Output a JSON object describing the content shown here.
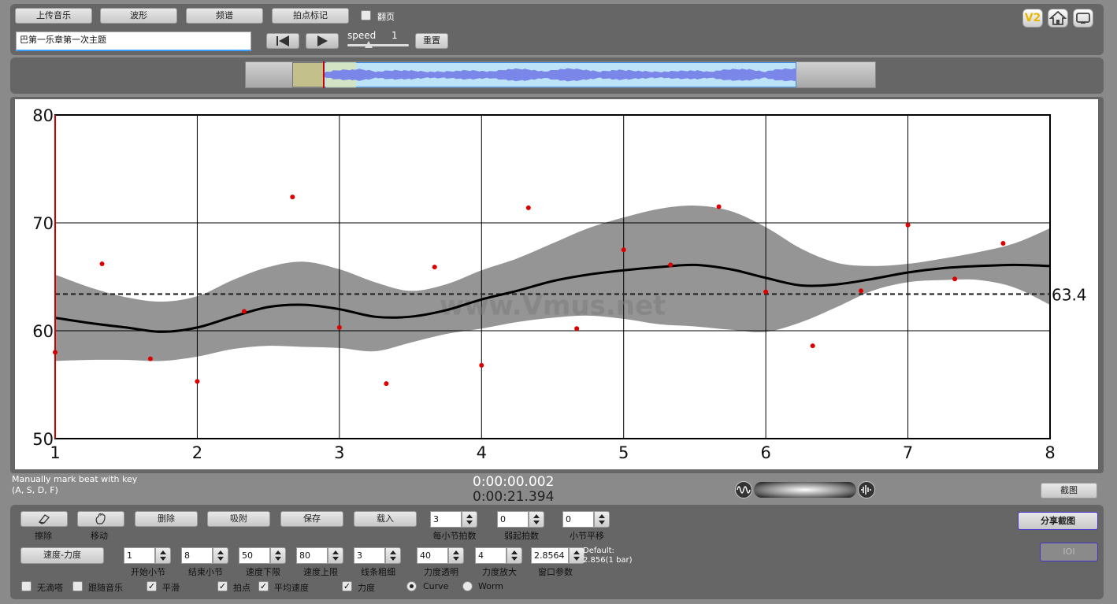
{
  "toolbar": {
    "upload_label": "上传音乐",
    "waveform_label": "波形",
    "spectrum_label": "频谱",
    "beat_mark_label": "拍点标记",
    "page_turn_label": "翻页",
    "piece_title": "巴第一乐章第一次主题",
    "speed_label": "speed",
    "speed_value": "1",
    "reset_label": "重置"
  },
  "top_icons": {
    "v2": "V2",
    "home": "home-icon",
    "screen": "screen-icon"
  },
  "chart_data": {
    "type": "scatter",
    "x_ticks": [
      "1",
      "2",
      "3",
      "4",
      "5",
      "6",
      "7",
      "8"
    ],
    "y_ticks": [
      "80",
      "70",
      "60",
      "50"
    ],
    "xlim": [
      1,
      8
    ],
    "ylim": [
      50,
      80
    ],
    "grid": true,
    "watermark": "www.Vmus.net",
    "average_value": 63.4,
    "average_label": "63.4",
    "points": [
      [
        1.0,
        58.0
      ],
      [
        1.33,
        66.2
      ],
      [
        1.67,
        57.4
      ],
      [
        2.0,
        55.3
      ],
      [
        2.33,
        61.8
      ],
      [
        2.67,
        72.4
      ],
      [
        3.0,
        60.3
      ],
      [
        3.33,
        55.1
      ],
      [
        3.67,
        65.9
      ],
      [
        4.0,
        56.8
      ],
      [
        4.33,
        71.4
      ],
      [
        4.67,
        60.2
      ],
      [
        5.0,
        67.5
      ],
      [
        5.33,
        66.1
      ],
      [
        5.67,
        71.5
      ],
      [
        6.0,
        63.6
      ],
      [
        6.33,
        58.6
      ],
      [
        6.67,
        63.7
      ],
      [
        7.0,
        69.8
      ],
      [
        7.33,
        64.8
      ],
      [
        7.67,
        68.1
      ]
    ],
    "curve": [
      [
        1.0,
        61.2
      ],
      [
        1.25,
        60.7
      ],
      [
        1.5,
        60.3
      ],
      [
        1.75,
        59.9
      ],
      [
        2.0,
        60.3
      ],
      [
        2.25,
        61.3
      ],
      [
        2.5,
        62.2
      ],
      [
        2.75,
        62.4
      ],
      [
        3.0,
        62.0
      ],
      [
        3.25,
        61.3
      ],
      [
        3.5,
        61.3
      ],
      [
        3.75,
        61.9
      ],
      [
        4.0,
        62.9
      ],
      [
        4.25,
        63.7
      ],
      [
        4.5,
        64.6
      ],
      [
        4.75,
        65.2
      ],
      [
        5.0,
        65.6
      ],
      [
        5.25,
        65.9
      ],
      [
        5.5,
        66.1
      ],
      [
        5.75,
        65.7
      ],
      [
        6.0,
        64.9
      ],
      [
        6.25,
        64.2
      ],
      [
        6.5,
        64.3
      ],
      [
        6.75,
        64.8
      ],
      [
        7.0,
        65.4
      ],
      [
        7.25,
        65.8
      ],
      [
        7.5,
        66.0
      ],
      [
        7.75,
        66.1
      ],
      [
        8.0,
        66.0
      ]
    ],
    "band_upper": [
      [
        1.0,
        65.2
      ],
      [
        1.25,
        64.0
      ],
      [
        1.5,
        63.1
      ],
      [
        1.75,
        62.7
      ],
      [
        2.0,
        63.2
      ],
      [
        2.25,
        64.7
      ],
      [
        2.5,
        65.9
      ],
      [
        2.75,
        66.4
      ],
      [
        3.0,
        65.7
      ],
      [
        3.25,
        64.5
      ],
      [
        3.5,
        63.7
      ],
      [
        3.75,
        64.3
      ],
      [
        4.0,
        65.6
      ],
      [
        4.25,
        66.7
      ],
      [
        4.5,
        68.1
      ],
      [
        4.75,
        69.5
      ],
      [
        5.0,
        70.5
      ],
      [
        5.25,
        71.3
      ],
      [
        5.5,
        71.6
      ],
      [
        5.75,
        71.1
      ],
      [
        6.0,
        69.6
      ],
      [
        6.25,
        67.6
      ],
      [
        6.5,
        66.3
      ],
      [
        6.75,
        66.0
      ],
      [
        7.0,
        66.2
      ],
      [
        7.25,
        66.7
      ],
      [
        7.5,
        67.3
      ],
      [
        7.75,
        68.1
      ],
      [
        8.0,
        69.5
      ]
    ],
    "band_lower": [
      [
        1.0,
        57.2
      ],
      [
        1.25,
        57.3
      ],
      [
        1.5,
        57.3
      ],
      [
        1.75,
        57.2
      ],
      [
        2.0,
        57.6
      ],
      [
        2.25,
        58.3
      ],
      [
        2.5,
        58.6
      ],
      [
        2.75,
        58.5
      ],
      [
        3.0,
        58.4
      ],
      [
        3.25,
        58.1
      ],
      [
        3.5,
        58.9
      ],
      [
        3.75,
        59.7
      ],
      [
        4.0,
        60.2
      ],
      [
        4.25,
        60.8
      ],
      [
        4.5,
        61.2
      ],
      [
        4.75,
        61.4
      ],
      [
        5.0,
        61.1
      ],
      [
        5.25,
        60.6
      ],
      [
        5.5,
        60.4
      ],
      [
        5.75,
        60.1
      ],
      [
        6.0,
        59.9
      ],
      [
        6.25,
        60.8
      ],
      [
        6.5,
        62.2
      ],
      [
        6.75,
        63.7
      ],
      [
        7.0,
        64.5
      ],
      [
        7.25,
        64.7
      ],
      [
        7.5,
        64.7
      ],
      [
        7.75,
        64.0
      ],
      [
        8.0,
        62.4
      ]
    ]
  },
  "status": {
    "hint_line1": "Manually mark beat with key",
    "hint_line2": "(A, S, D, F)",
    "time_current": "0:00:00.002",
    "time_total": "0:00:21.394",
    "screenshot_label": "截图"
  },
  "tools": {
    "erase_label": "擦除",
    "move_label": "移动",
    "delete_label": "删除",
    "snap_label": "吸附",
    "save_label": "保存",
    "load_label": "载入",
    "share_label": "分享截图",
    "ioi_label": "IOI",
    "mode_label": "速度-力度"
  },
  "params": {
    "beats_per_bar": {
      "label": "每小节拍数",
      "value": "3"
    },
    "pickup_beats": {
      "label": "弱起拍数",
      "value": "0"
    },
    "bar_shift": {
      "label": "小节平移",
      "value": "0"
    },
    "start_bar": {
      "label": "开始小节",
      "value": "1"
    },
    "end_bar": {
      "label": "结束小节",
      "value": "8"
    },
    "tempo_min": {
      "label": "速度下限",
      "value": "50"
    },
    "tempo_max": {
      "label": "速度上限",
      "value": "80"
    },
    "line_width": {
      "label": "线条粗细",
      "value": "3"
    },
    "dyn_transparency": {
      "label": "力度透明",
      "value": "40"
    },
    "dyn_scale": {
      "label": "力度放大",
      "value": "4"
    },
    "window_param": {
      "label": "窗口参数",
      "value": "2.8564"
    },
    "default_line1": "Default:",
    "default_line2": "2.856(1 bar)"
  },
  "options": {
    "no_sound": {
      "label": "无滴嗒",
      "checked": false
    },
    "follow_music": {
      "label": "跟随音乐",
      "checked": false
    },
    "smooth": {
      "label": "平滑",
      "checked": true
    },
    "beats": {
      "label": "拍点",
      "checked": true
    },
    "avg_tempo": {
      "label": "平均速度",
      "checked": true
    },
    "dynamics": {
      "label": "力度",
      "checked": true
    },
    "curve": {
      "label": "Curve",
      "selected": true
    },
    "worm": {
      "label": "Worm",
      "selected": false
    }
  },
  "colors": {
    "band": "#959595",
    "points": "#dd0000",
    "cursor": "#cc0000",
    "wave": "#7a86e8",
    "overview_sel": "#bde3f9"
  }
}
